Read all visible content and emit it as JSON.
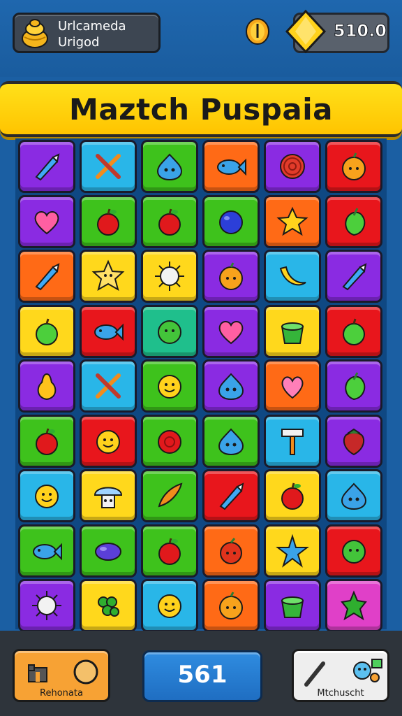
{
  "header": {
    "profile_line1": "Urlcameda",
    "profile_line2": "Urigod",
    "currency_value": "510.0"
  },
  "banner": {
    "title": "Maztch Puspaia"
  },
  "board": {
    "rows": 9,
    "cols": 6,
    "colors": {
      "purple": "#8a2be2",
      "cyan": "#29b6e8",
      "green": "#3ec21c",
      "orange": "#ff6a16",
      "red": "#e8161c",
      "yellow": "#ffd81c",
      "teal": "#1fbf8c",
      "pink": "#e040c8"
    },
    "tiles": [
      [
        "purple:rocket-icon",
        "cyan:crossed-tools-icon",
        "green:blob-icon",
        "orange:fish-icon",
        "purple:shell-icon",
        "red:orange-fruit-icon"
      ],
      [
        "purple:heart-icon",
        "green:apple-icon",
        "green:apple-icon",
        "green:blue-ball-icon",
        "orange:star-icon",
        "red:leaf-fruit-icon"
      ],
      [
        "orange:rocket-icon",
        "yellow:star-face-icon",
        "yellow:urchin-icon",
        "purple:orange-fruit-icon",
        "cyan:banana-icon",
        "purple:rocket-icon"
      ],
      [
        "yellow:green-apple-icon",
        "red:fish-icon",
        "teal:green-ball-icon",
        "purple:heart-icon",
        "yellow:pot-icon",
        "red:green-apple-icon"
      ],
      [
        "purple:pear-icon",
        "cyan:crossed-tools-icon",
        "green:smiley-icon",
        "purple:blob-icon",
        "orange:heart-blob-icon",
        "purple:leaf-fruit-icon"
      ],
      [
        "green:apple-icon",
        "red:smiley-icon",
        "green:red-ball-icon",
        "green:blob-icon",
        "cyan:hammer-icon",
        "purple:strawberry-icon"
      ],
      [
        "cyan:smiley-icon",
        "yellow:mushroom-icon",
        "green:carrot-icon",
        "red:rocket-icon",
        "yellow:apple-icon",
        "cyan:blob-icon"
      ],
      [
        "green:fish-icon",
        "green:bean-icon",
        "green:apple-icon",
        "orange:berry-icon",
        "yellow:starfish-icon",
        "red:green-ball-icon"
      ],
      [
        "purple:urchin-icon",
        "yellow:grapes-icon",
        "cyan:smiley-icon",
        "orange:orange-fruit-icon",
        "purple:pot-icon",
        "pink:leaf-icon"
      ]
    ]
  },
  "footer": {
    "left_button_label": "Rehonata",
    "score": "561",
    "right_button_label": "Mtchuscht"
  }
}
